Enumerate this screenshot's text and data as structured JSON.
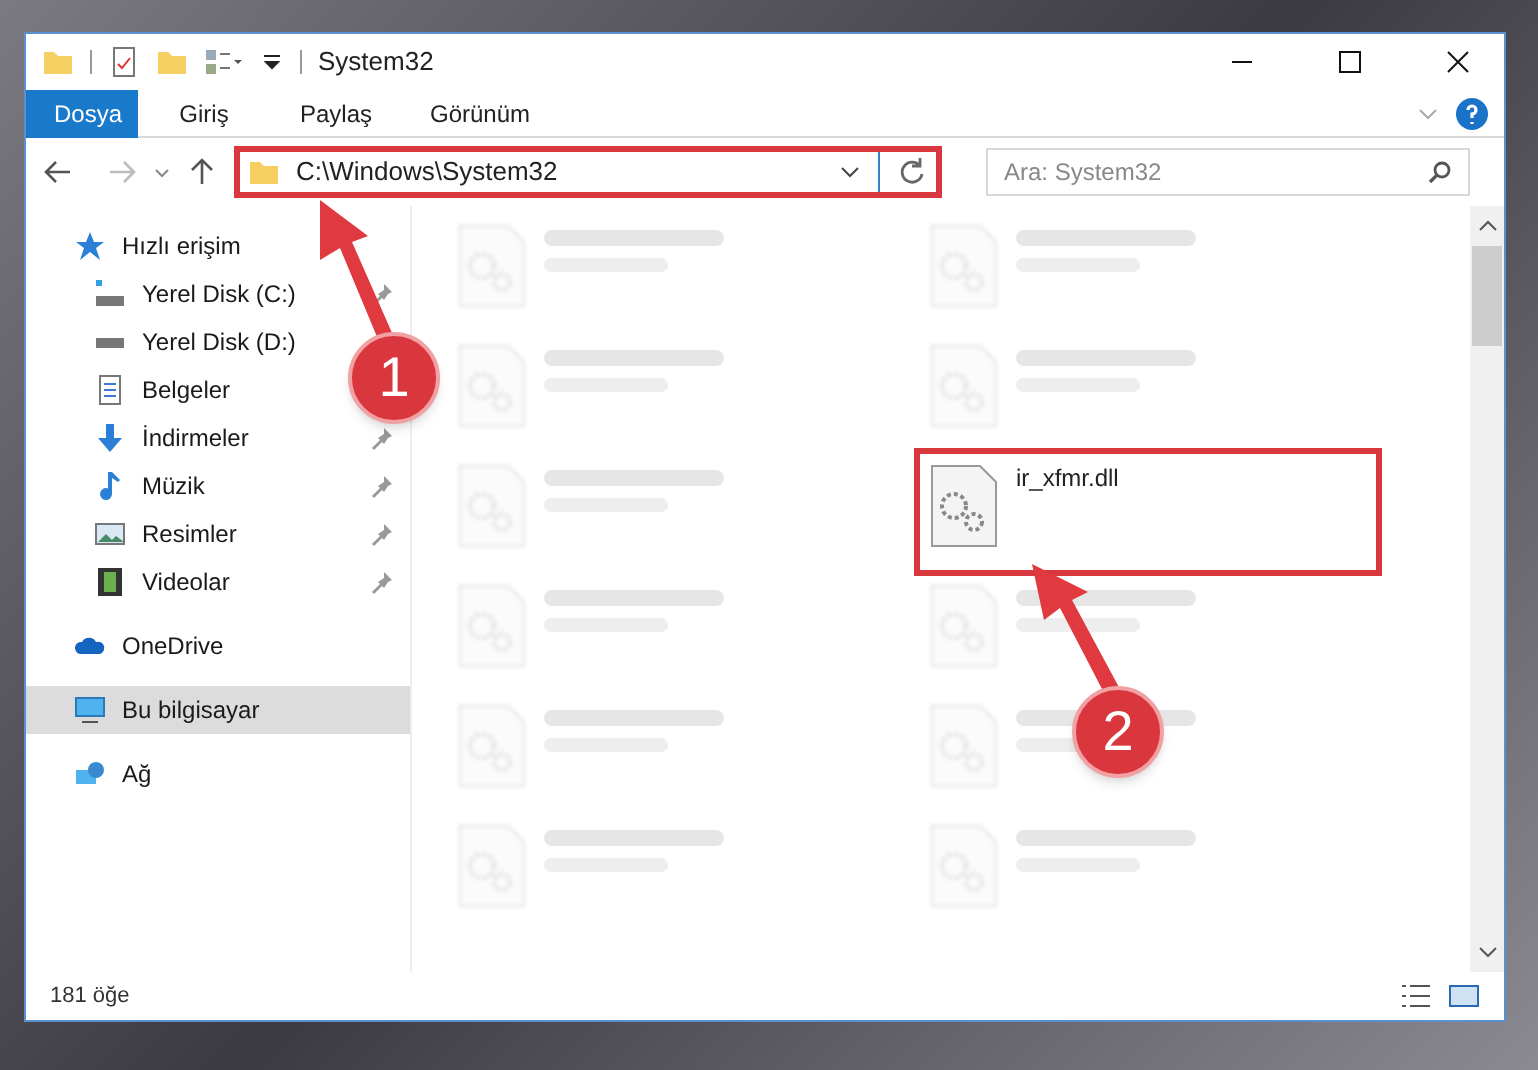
{
  "window": {
    "title": "System32"
  },
  "ribbon_tabs": [
    {
      "label": "Dosya",
      "selected": true
    },
    {
      "label": "Giriş",
      "selected": false
    },
    {
      "label": "Paylaş",
      "selected": false
    },
    {
      "label": "Görünüm",
      "selected": false
    }
  ],
  "address": {
    "value": "C:\\Windows\\System32",
    "highlighted": true
  },
  "search": {
    "placeholder": "Ara: System32"
  },
  "sidebar": {
    "items": [
      {
        "label": "Hızlı erişim",
        "kind": "star",
        "selected": false,
        "children": [
          {
            "label": "Yerel Disk (C:)",
            "kind": "disk-c",
            "selected": false,
            "pinned": true
          },
          {
            "label": "Yerel Disk (D:)",
            "kind": "disk",
            "selected": false
          },
          {
            "label": "Belgeler",
            "kind": "docs",
            "selected": false
          },
          {
            "label": "İndirmeler",
            "kind": "download",
            "selected": false,
            "pinned": true
          },
          {
            "label": "Müzik",
            "kind": "music",
            "selected": false,
            "pinned": true
          },
          {
            "label": "Resimler",
            "kind": "pictures",
            "selected": false,
            "pinned": true
          },
          {
            "label": "Videolar",
            "kind": "video",
            "selected": false,
            "pinned": true
          }
        ]
      },
      {
        "label": "OneDrive",
        "kind": "cloud",
        "selected": false
      },
      {
        "label": "Bu bilgisayar",
        "kind": "pc",
        "selected": true
      },
      {
        "label": "Ağ",
        "kind": "network",
        "selected": false
      }
    ]
  },
  "files": [
    {
      "kind": "blurred"
    },
    {
      "kind": "blurred"
    },
    {
      "kind": "blurred"
    },
    {
      "kind": "blurred"
    },
    {
      "kind": "blurred"
    },
    {
      "kind": "file",
      "name": "ir_xfmr.dll",
      "highlighted": true
    },
    {
      "kind": "blurred"
    },
    {
      "kind": "blurred"
    },
    {
      "kind": "blurred"
    },
    {
      "kind": "blurred"
    },
    {
      "kind": "blurred"
    },
    {
      "kind": "blurred"
    }
  ],
  "status_bar": {
    "count": "181 öğe"
  },
  "annotations": [
    {
      "label": "1"
    },
    {
      "label": "2"
    }
  ]
}
